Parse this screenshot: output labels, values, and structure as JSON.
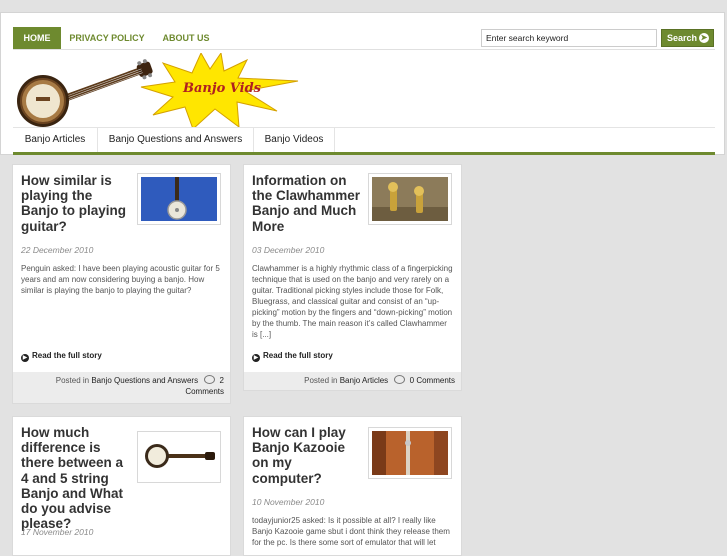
{
  "topnav": {
    "items": [
      {
        "label": "HOME",
        "active": true
      },
      {
        "label": "PRIVACY POLICY",
        "active": false
      },
      {
        "label": "ABOUT US",
        "active": false
      }
    ],
    "search_placeholder": "Enter search keyword",
    "search_button": "Search"
  },
  "logo": {
    "text": "Banjo Vids"
  },
  "mainnav": {
    "items": [
      {
        "label": "Banjo Articles"
      },
      {
        "label": "Banjo Questions and Answers"
      },
      {
        "label": "Banjo Videos"
      }
    ]
  },
  "colors": {
    "accent": "#6e8a2f",
    "star": "#ffe600",
    "star_stroke": "#d4a000"
  },
  "posts": [
    {
      "title": "How similar is playing the Banjo to playing guitar?",
      "date": "22 December 2010",
      "excerpt": "Penguin asked: I have been playing acoustic guitar for 5 years and am now considering buying a banjo. How similar is playing the banjo to playing the guitar?",
      "read_more": "Read the full story",
      "posted_in": "Posted in",
      "category": "Banjo Questions and Answers",
      "comments": "2 Comments"
    },
    {
      "title": "Information on the Clawhammer Banjo and Much More",
      "date": "03 December 2010",
      "excerpt": "Clawhammer is a highly rhythmic class of a fingerpicking technique that is used on the banjo and very rarely on a guitar. Traditional picking styles include those for Folk, Bluegrass, and classical guitar and consist of an “up-picking” motion by the fingers and “down-picking” motion by the thumb. The main reason it’s called Clawhammer is [...]",
      "read_more": "Read the full story",
      "posted_in": "Posted in",
      "category": "Banjo Articles",
      "comments": "0 Comments"
    },
    {
      "title": "How much difference is there between a 4 and 5 string Banjo and What do you advise please?",
      "date": "17 November 2010"
    },
    {
      "title": "How can I play Banjo Kazooie on my computer?",
      "date": "10 November 2010",
      "excerpt": "todayjunior25 asked: Is it possible at all? I really like Banjo Kazooie game sbut i dont think they release them for the pc. Is there some sort of emulator that will let"
    }
  ]
}
